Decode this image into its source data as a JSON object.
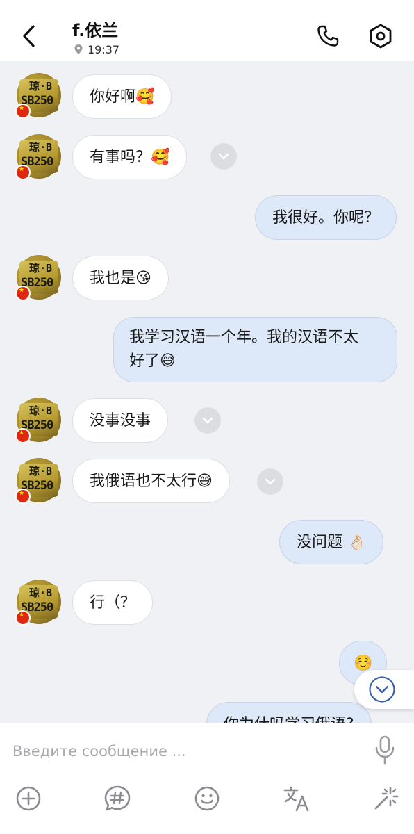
{
  "header": {
    "contact_name": "f.依兰",
    "status_time": "19:37"
  },
  "avatar": {
    "plate_line1": "琼·B",
    "plate_line2": "SB250"
  },
  "messages": [
    {
      "direction": "in",
      "text": "你好啊🥰"
    },
    {
      "direction": "in",
      "text": "有事吗？🥰"
    },
    {
      "direction": "out",
      "text": "我很好。你呢？"
    },
    {
      "direction": "in",
      "text": "我也是😘"
    },
    {
      "direction": "out",
      "line1": "我学习汉语一个年。我的汉语不太",
      "line2": "好了😅"
    },
    {
      "direction": "in",
      "text": "没事没事"
    },
    {
      "direction": "in",
      "text": "我俄语也不太行😅"
    },
    {
      "direction": "out",
      "text": "没问题 👌🏻"
    },
    {
      "direction": "in",
      "text": "行（？"
    },
    {
      "direction": "out",
      "text": "☺️"
    },
    {
      "direction": "out",
      "text": "你为什吗学习俄语?"
    }
  ],
  "composer": {
    "placeholder": "Введите сообщение ..."
  },
  "icons": {
    "back": "chevron-left-icon",
    "location": "location-pin-icon",
    "call": "phone-icon",
    "settings": "settings-hexagon-icon",
    "translate_toggle": "chevron-down-icon",
    "scroll_down": "chevron-down-circle-icon",
    "mic": "microphone-icon",
    "add": "plus-circle-icon",
    "hashtag": "hashtag-bubble-icon",
    "emoji": "smiley-icon",
    "translate": "translate-icon",
    "magic": "sparkle-icon"
  },
  "colors": {
    "background": "#eff1f5",
    "incoming_bubble": "#ffffff",
    "outgoing_bubble": "#dde8f8",
    "accent": "#3b5fa8"
  }
}
